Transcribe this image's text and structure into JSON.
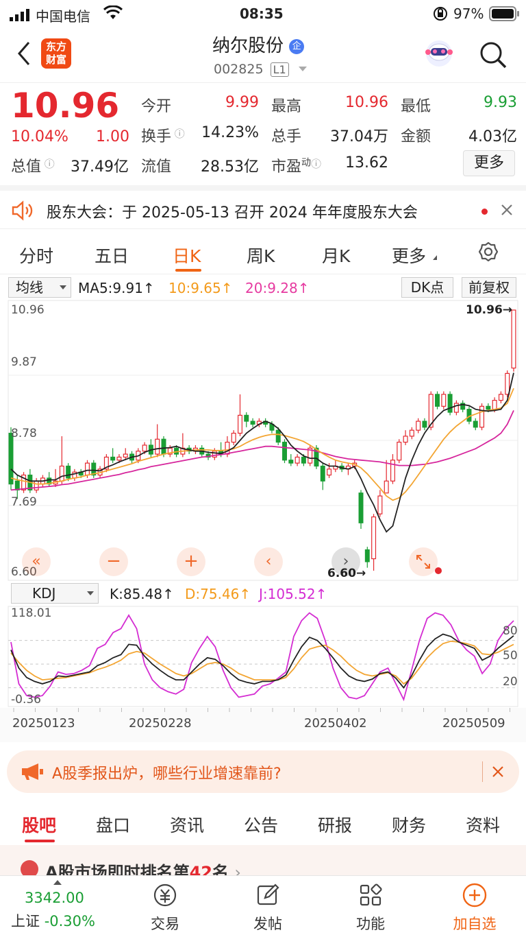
{
  "status": {
    "carrier": "中国电信",
    "time": "08:35",
    "battery": "97%"
  },
  "nav": {
    "logo_line1": "东方",
    "logo_line2": "财富",
    "title": "纳尔股份",
    "badge": "企",
    "code": "002825",
    "level": "L1"
  },
  "quote": {
    "price": "10.96",
    "change_pct": "10.04%",
    "change": "1.00",
    "open_label": "今开",
    "open": "9.99",
    "high_label": "最高",
    "high": "10.96",
    "low_label": "最低",
    "low": "9.93",
    "turnover_label": "换手",
    "turnover": "14.23%",
    "volume_label": "总手",
    "volume": "37.04万",
    "amount_label": "金额",
    "amount": "4.03亿",
    "mktcap_label": "总值",
    "mktcap": "37.49亿",
    "float_label": "流值",
    "float": "28.53亿",
    "pe_label": "市盈",
    "pe_sup": "动",
    "pe": "13.62",
    "more": "更多"
  },
  "notice": {
    "text": "股东大会：于 2025-05-13 召开 2024 年年度股东大会"
  },
  "tabs": [
    "分时",
    "五日",
    "日K",
    "周K",
    "月K",
    "更多"
  ],
  "chart": {
    "ma_select": "均线",
    "ma5": "MA5:9.91↑",
    "ma10": "10:9.65↑",
    "ma20": "20:9.28↑",
    "dk": "DK点",
    "adjust": "前复权",
    "y_labels": [
      "10.96",
      "9.87",
      "8.78",
      "7.69",
      "6.60"
    ],
    "high_marker": "10.96→",
    "low_marker": "6.60→",
    "kdj_select": "KDJ",
    "k": "K:85.48↑",
    "d": "D:75.46↑",
    "j": "J:105.52↑",
    "kdj_y_top": "118.01",
    "kdj_y_bottom": "-0.36",
    "kdj_levels": [
      "80",
      "50",
      "20"
    ],
    "dates": [
      "20250123",
      "20250228",
      "20250402",
      "20250509"
    ],
    "colors": {
      "up": "#e4282f",
      "down": "#1a9e34",
      "ma5": "#222222",
      "ma10": "#f3a532",
      "ma20": "#d6259c",
      "j": "#d42cd2"
    }
  },
  "chart_data": {
    "type": "candlestick",
    "ylim": [
      6.6,
      10.96
    ],
    "candles": [
      [
        8.9,
        8.05,
        9.0,
        7.95
      ],
      [
        8.1,
        7.95,
        8.2,
        7.8
      ],
      [
        7.95,
        8.2,
        8.25,
        7.9
      ],
      [
        8.2,
        7.95,
        8.3,
        7.9
      ],
      [
        7.95,
        8.1,
        8.15,
        7.9
      ],
      [
        8.05,
        8.15,
        8.2,
        8.0
      ],
      [
        8.15,
        8.05,
        8.25,
        8.0
      ],
      [
        8.05,
        8.1,
        8.3,
        8.0
      ],
      [
        8.1,
        8.35,
        8.85,
        8.05
      ],
      [
        8.35,
        8.15,
        8.4,
        8.1
      ],
      [
        8.15,
        8.25,
        8.3,
        8.1
      ],
      [
        8.25,
        8.2,
        8.3,
        8.15
      ],
      [
        8.2,
        8.4,
        8.45,
        8.15
      ],
      [
        8.4,
        8.2,
        8.45,
        8.15
      ],
      [
        8.2,
        8.3,
        8.35,
        8.15
      ],
      [
        8.3,
        8.5,
        8.55,
        8.25
      ],
      [
        8.5,
        8.45,
        8.65,
        8.4
      ],
      [
        8.45,
        8.5,
        8.55,
        8.4
      ],
      [
        8.5,
        8.55,
        8.65,
        8.45
      ],
      [
        8.55,
        8.45,
        8.6,
        8.4
      ],
      [
        8.45,
        8.6,
        8.65,
        8.4
      ],
      [
        8.6,
        8.7,
        8.75,
        8.55
      ],
      [
        8.7,
        8.55,
        8.8,
        8.5
      ],
      [
        8.55,
        8.8,
        9.05,
        8.5
      ],
      [
        8.8,
        8.55,
        8.85,
        8.5
      ],
      [
        8.55,
        8.65,
        8.7,
        8.5
      ],
      [
        8.65,
        8.55,
        8.7,
        8.5
      ],
      [
        8.55,
        8.65,
        8.9,
        8.5
      ],
      [
        8.65,
        8.6,
        8.7,
        8.55
      ],
      [
        8.6,
        8.65,
        8.7,
        8.55
      ],
      [
        8.65,
        8.55,
        8.7,
        8.5
      ],
      [
        8.55,
        8.5,
        8.6,
        8.45
      ],
      [
        8.5,
        8.6,
        8.65,
        8.45
      ],
      [
        8.6,
        8.55,
        8.75,
        8.5
      ],
      [
        8.55,
        8.75,
        8.85,
        8.5
      ],
      [
        8.75,
        8.9,
        8.95,
        8.7
      ],
      [
        8.9,
        9.2,
        9.55,
        8.85
      ],
      [
        9.2,
        9.1,
        9.25,
        9.0
      ],
      [
        9.1,
        9.05,
        9.15,
        9.0
      ],
      [
        9.05,
        9.1,
        9.15,
        9.0
      ],
      [
        9.1,
        9.05,
        9.15,
        9.0
      ],
      [
        9.05,
        8.95,
        9.1,
        8.9
      ],
      [
        8.95,
        8.75,
        9.0,
        8.7
      ],
      [
        8.75,
        8.45,
        8.8,
        8.4
      ],
      [
        8.45,
        8.4,
        8.55,
        8.35
      ],
      [
        8.4,
        8.5,
        8.55,
        8.35
      ],
      [
        8.5,
        8.4,
        8.55,
        8.35
      ],
      [
        8.4,
        8.65,
        8.7,
        8.35
      ],
      [
        8.65,
        8.35,
        8.7,
        8.3
      ],
      [
        8.35,
        8.1,
        8.4,
        7.95
      ],
      [
        8.2,
        8.3,
        8.4,
        8.15
      ],
      [
        8.3,
        8.35,
        8.45,
        8.25
      ],
      [
        8.35,
        8.3,
        8.4,
        8.25
      ],
      [
        8.3,
        8.35,
        8.4,
        8.2
      ],
      [
        8.35,
        8.4,
        8.45,
        8.3
      ],
      [
        7.9,
        7.4,
        7.95,
        7.3
      ],
      [
        6.95,
        6.75,
        7.0,
        6.65
      ],
      [
        6.8,
        7.5,
        7.55,
        6.6
      ],
      [
        7.55,
        7.85,
        7.95,
        7.5
      ],
      [
        7.9,
        8.1,
        8.45,
        7.9
      ],
      [
        8.1,
        8.45,
        8.55,
        8.05
      ],
      [
        8.45,
        8.75,
        8.8,
        8.4
      ],
      [
        8.75,
        8.85,
        8.95,
        8.7
      ],
      [
        8.85,
        8.95,
        9.0,
        8.8
      ],
      [
        8.95,
        9.1,
        9.15,
        8.9
      ],
      [
        9.1,
        9.0,
        9.15,
        8.95
      ],
      [
        9.0,
        9.55,
        9.6,
        8.95
      ],
      [
        9.55,
        9.35,
        9.6,
        9.3
      ],
      [
        9.35,
        9.55,
        9.6,
        9.3
      ],
      [
        9.55,
        9.25,
        9.6,
        9.2
      ],
      [
        9.25,
        9.4,
        9.45,
        9.2
      ],
      [
        9.4,
        9.3,
        9.45,
        9.25
      ],
      [
        9.3,
        9.1,
        9.35,
        9.05
      ],
      [
        9.1,
        9.0,
        9.15,
        8.95
      ],
      [
        9.0,
        9.35,
        9.4,
        8.95
      ],
      [
        9.35,
        9.3,
        9.4,
        9.25
      ],
      [
        9.3,
        9.45,
        9.5,
        9.25
      ],
      [
        9.45,
        9.55,
        9.6,
        9.4
      ],
      [
        9.55,
        9.9,
        9.95,
        9.5
      ],
      [
        9.99,
        10.96,
        10.96,
        9.93
      ]
    ],
    "ma5": [
      8.3,
      8.2,
      8.15,
      8.1,
      8.1,
      8.1,
      8.12,
      8.12,
      8.18,
      8.2,
      8.22,
      8.25,
      8.28,
      8.28,
      8.27,
      8.33,
      8.37,
      8.42,
      8.46,
      8.5,
      8.52,
      8.58,
      8.62,
      8.64,
      8.65,
      8.66,
      8.68,
      8.64,
      8.62,
      8.6,
      8.6,
      8.58,
      8.57,
      8.56,
      8.6,
      8.66,
      8.78,
      8.9,
      8.98,
      9.05,
      9.1,
      9.06,
      8.98,
      8.85,
      8.7,
      8.6,
      8.52,
      8.48,
      8.48,
      8.4,
      8.35,
      8.35,
      8.32,
      8.3,
      8.34,
      8.14,
      7.9,
      7.7,
      7.45,
      7.25,
      7.35,
      7.75,
      8.15,
      8.45,
      8.7,
      8.9,
      9.05,
      9.18,
      9.28,
      9.32,
      9.36,
      9.38,
      9.36,
      9.3,
      9.28,
      9.27,
      9.28,
      9.3,
      9.45,
      9.91
    ],
    "ma10": [
      8.15,
      8.12,
      8.1,
      8.08,
      8.05,
      8.05,
      8.06,
      8.08,
      8.1,
      8.13,
      8.15,
      8.17,
      8.2,
      8.22,
      8.24,
      8.27,
      8.3,
      8.33,
      8.36,
      8.39,
      8.43,
      8.46,
      8.49,
      8.52,
      8.55,
      8.57,
      8.59,
      8.6,
      8.61,
      8.62,
      8.62,
      8.62,
      8.61,
      8.61,
      8.62,
      8.64,
      8.68,
      8.74,
      8.79,
      8.83,
      8.86,
      8.88,
      8.88,
      8.86,
      8.83,
      8.8,
      8.76,
      8.7,
      8.63,
      8.56,
      8.5,
      8.45,
      8.42,
      8.4,
      8.38,
      8.32,
      8.22,
      8.1,
      7.98,
      7.85,
      7.78,
      7.82,
      7.92,
      8.05,
      8.2,
      8.35,
      8.5,
      8.65,
      8.8,
      8.92,
      9.02,
      9.1,
      9.18,
      9.22,
      9.26,
      9.28,
      9.3,
      9.32,
      9.4,
      9.65
    ],
    "ma20": [
      7.95,
      7.96,
      7.97,
      7.98,
      7.99,
      8.0,
      8.01,
      8.02,
      8.04,
      8.05,
      8.07,
      8.09,
      8.11,
      8.13,
      8.15,
      8.17,
      8.19,
      8.21,
      8.24,
      8.26,
      8.29,
      8.31,
      8.34,
      8.36,
      8.38,
      8.4,
      8.42,
      8.44,
      8.46,
      8.48,
      8.5,
      8.51,
      8.53,
      8.54,
      8.56,
      8.58,
      8.6,
      8.62,
      8.64,
      8.66,
      8.68,
      8.68,
      8.67,
      8.66,
      8.65,
      8.64,
      8.63,
      8.62,
      8.6,
      8.57,
      8.54,
      8.51,
      8.49,
      8.47,
      8.46,
      8.45,
      8.44,
      8.43,
      8.42,
      8.4,
      8.38,
      8.36,
      8.36,
      8.36,
      8.37,
      8.38,
      8.4,
      8.42,
      8.45,
      8.48,
      8.52,
      8.56,
      8.6,
      8.64,
      8.7,
      8.76,
      8.82,
      8.9,
      9.05,
      9.28
    ],
    "kdj_ylim": [
      -0.36,
      118.01
    ],
    "K": [
      68,
      45,
      33,
      28,
      25,
      28,
      35,
      34,
      36,
      38,
      40,
      48,
      52,
      58,
      62,
      75,
      74,
      60,
      50,
      42,
      35,
      30,
      30,
      40,
      50,
      58,
      56,
      48,
      38,
      30,
      27,
      25,
      28,
      28,
      30,
      36,
      55,
      72,
      84,
      80,
      70,
      58,
      45,
      35,
      30,
      28,
      31,
      38,
      40,
      32,
      20,
      35,
      55,
      72,
      82,
      88,
      85,
      78,
      74,
      70,
      55,
      60,
      70,
      78,
      86
    ],
    "D": [
      64,
      52,
      42,
      35,
      30,
      31,
      32,
      33,
      35,
      37,
      39,
      43,
      46,
      50,
      55,
      63,
      66,
      64,
      57,
      50,
      44,
      38,
      35,
      38,
      44,
      50,
      52,
      50,
      45,
      38,
      34,
      30,
      30,
      30,
      30,
      33,
      44,
      58,
      69,
      72,
      74,
      68,
      60,
      50,
      42,
      37,
      35,
      37,
      39,
      35,
      25,
      32,
      45,
      58,
      68,
      76,
      79,
      78,
      76,
      73,
      63,
      62,
      65,
      70,
      75
    ],
    "J": [
      78,
      25,
      10,
      8,
      10,
      22,
      40,
      37,
      38,
      42,
      48,
      70,
      75,
      90,
      95,
      112,
      95,
      50,
      30,
      20,
      15,
      12,
      18,
      52,
      70,
      85,
      72,
      42,
      20,
      8,
      10,
      12,
      22,
      25,
      32,
      40,
      85,
      105,
      115,
      108,
      80,
      45,
      20,
      8,
      6,
      10,
      25,
      40,
      45,
      25,
      5,
      42,
      80,
      108,
      115,
      112,
      100,
      80,
      68,
      60,
      38,
      50,
      80,
      95,
      105
    ]
  },
  "ad": {
    "text": "A股季报出炉，哪些行业增速靠前?"
  },
  "bottom_tabs": [
    "股吧",
    "盘口",
    "资讯",
    "公告",
    "研报",
    "财务",
    "资料"
  ],
  "rank": {
    "prefix": "A股市场即时排名第",
    "num": "42",
    "suffix": "名"
  },
  "bottom": {
    "index_value": "3342.00",
    "index_name": "上证",
    "index_change": "-0.30%",
    "trade": "交易",
    "post": "发帖",
    "func": "功能",
    "watch": "加自选"
  }
}
